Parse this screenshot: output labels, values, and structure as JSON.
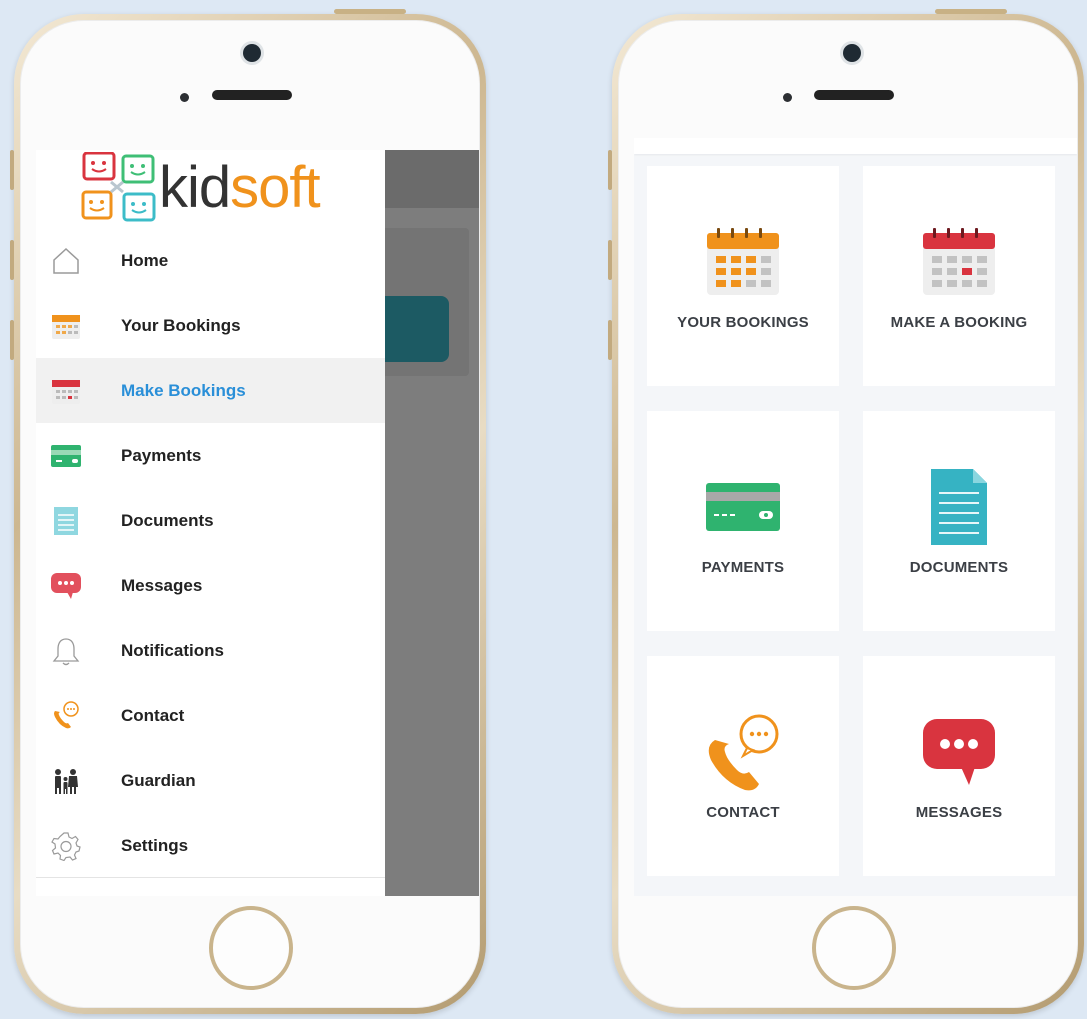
{
  "brand": {
    "logo_part1": "kid",
    "logo_part2": "soft"
  },
  "drawer": {
    "items": [
      {
        "label": "Home",
        "icon": "home-icon",
        "active": false
      },
      {
        "label": "Your Bookings",
        "icon": "calendar-orange-icon",
        "active": false
      },
      {
        "label": "Make Bookings",
        "icon": "calendar-red-icon",
        "active": true
      },
      {
        "label": "Payments",
        "icon": "credit-card-icon",
        "active": false
      },
      {
        "label": "Documents",
        "icon": "document-icon",
        "active": false
      },
      {
        "label": "Messages",
        "icon": "chat-bubble-icon",
        "active": false
      },
      {
        "label": "Notifications",
        "icon": "bell-icon",
        "active": false
      },
      {
        "label": "Contact",
        "icon": "phone-chat-icon",
        "active": false
      },
      {
        "label": "Guardian",
        "icon": "family-icon",
        "active": false
      },
      {
        "label": "Settings",
        "icon": "gear-icon",
        "active": false
      }
    ]
  },
  "dashboard": {
    "tiles": [
      {
        "label": "YOUR BOOKINGS",
        "icon": "calendar-orange-icon"
      },
      {
        "label": "MAKE A BOOKING",
        "icon": "calendar-red-icon"
      },
      {
        "label": "PAYMENTS",
        "icon": "credit-card-icon"
      },
      {
        "label": "DOCUMENTS",
        "icon": "document-icon"
      },
      {
        "label": "CONTACT",
        "icon": "phone-chat-icon"
      },
      {
        "label": "MESSAGES",
        "icon": "chat-bubble-icon"
      }
    ]
  },
  "colors": {
    "accent_blue": "#2a8fd8",
    "orange": "#f0921c",
    "red": "#d9343f",
    "green": "#2fb36f",
    "teal": "#3cbcc8",
    "overlay_teal": "#1c5a63"
  }
}
